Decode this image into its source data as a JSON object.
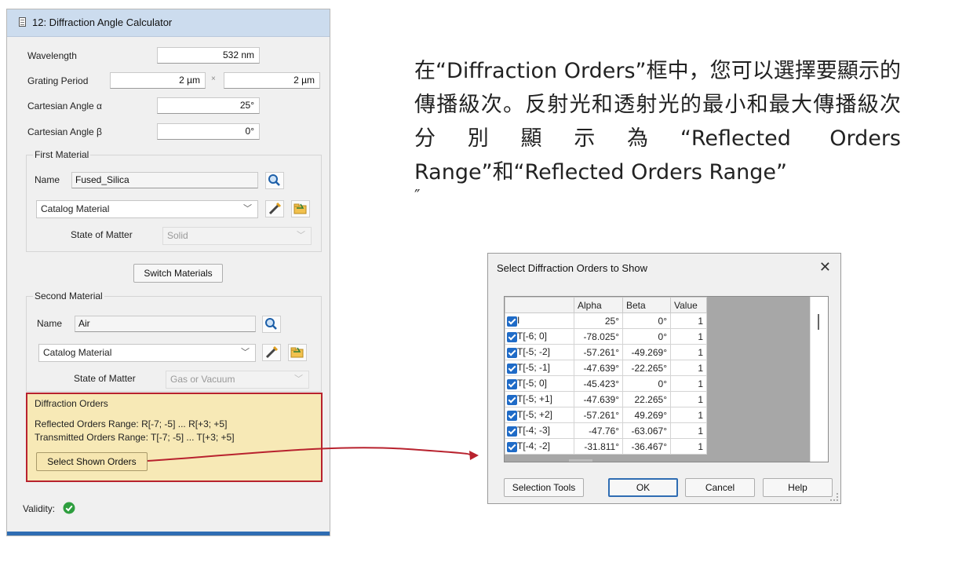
{
  "panel": {
    "title": "12: Diffraction Angle Calculator",
    "wavelength_label": "Wavelength",
    "wavelength_value": "532 nm",
    "grating_label": "Grating Period",
    "grating_value_1": "2 µm",
    "grating_times": "×",
    "grating_value_2": "2 µm",
    "alpha_label": "Cartesian Angle α",
    "alpha_value": "25°",
    "beta_label": "Cartesian Angle β",
    "beta_value": "0°",
    "first_material": {
      "group_title": "First Material",
      "name_label": "Name",
      "name_value": "Fused_Silica",
      "type_value": "Catalog Material",
      "state_label": "State of Matter",
      "state_value": "Solid"
    },
    "switch_label": "Switch Materials",
    "second_material": {
      "group_title": "Second Material",
      "name_label": "Name",
      "name_value": "Air",
      "type_value": "Catalog Material",
      "state_label": "State of Matter",
      "state_value": "Gas or Vacuum"
    },
    "diffraction": {
      "group_title": "Diffraction Orders",
      "reflected": "Reflected Orders Range: R[-7; -5] ... R[+3; +5]",
      "transmitted": "Transmitted Orders Range: T[-7; -5] ... T[+3; +5]",
      "select_button": "Select Shown Orders"
    },
    "validity_label": "Validity:"
  },
  "annotation": {
    "text": "在“Diffraction Orders”框中，您可以選擇要顯示的傳播級次。反射光和透射光的最小和最大傳播級次分別顯示為“Reflected Orders Range”和“Reflected Orders Range”",
    "stray_mark": "″"
  },
  "dialog": {
    "title": "Select Diffraction Orders to Show",
    "close_glyph": "✕",
    "columns": [
      "",
      "Alpha",
      "Beta",
      "Value"
    ],
    "rows": [
      {
        "label": "I",
        "alpha": "25°",
        "beta": "0°",
        "value": "1"
      },
      {
        "label": "T[-6; 0]",
        "alpha": "-78.025°",
        "beta": "0°",
        "value": "1"
      },
      {
        "label": "T[-5; -2]",
        "alpha": "-57.261°",
        "beta": "-49.269°",
        "value": "1"
      },
      {
        "label": "T[-5; -1]",
        "alpha": "-47.639°",
        "beta": "-22.265°",
        "value": "1"
      },
      {
        "label": "T[-5; 0]",
        "alpha": "-45.423°",
        "beta": "0°",
        "value": "1"
      },
      {
        "label": "T[-5; +1]",
        "alpha": "-47.639°",
        "beta": "22.265°",
        "value": "1"
      },
      {
        "label": "T[-5; +2]",
        "alpha": "-57.261°",
        "beta": "49.269°",
        "value": "1"
      },
      {
        "label": "T[-4; -3]",
        "alpha": "-47.76°",
        "beta": "-63.067°",
        "value": "1"
      },
      {
        "label": "T[-4; -2]",
        "alpha": "-31.811°",
        "beta": "-36.467°",
        "value": "1"
      }
    ],
    "buttons": {
      "selection_tools": "Selection Tools",
      "ok": "OK",
      "cancel": "Cancel",
      "help": "Help"
    }
  },
  "colors": {
    "highlight_border": "#b8222e",
    "highlight_fill": "#f7e9b6",
    "checkbox": "#1f6bc7",
    "validity_ok": "#2e9e3e",
    "arrow": "#b8222e"
  }
}
